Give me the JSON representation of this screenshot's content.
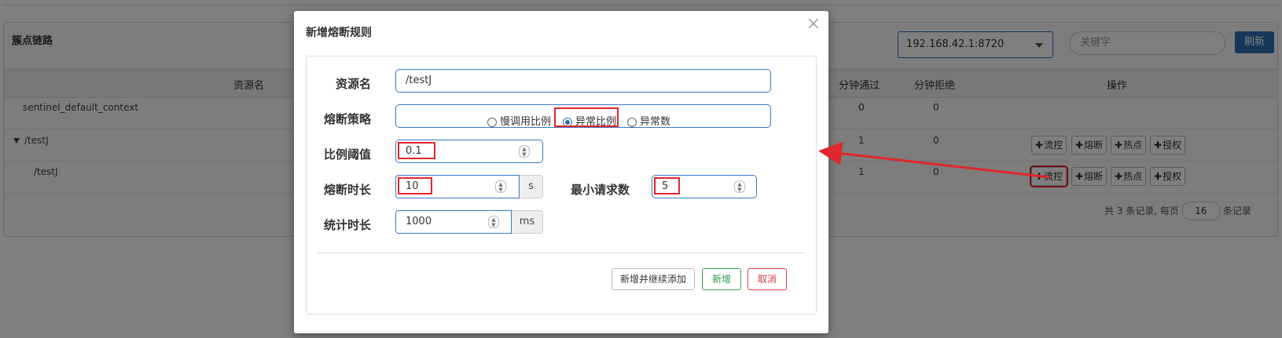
{
  "panel": {
    "title": "簇点链路",
    "machine_select": "192.168.42.1:8720",
    "keyword_placeholder": "关键字",
    "refresh_label": "刷新"
  },
  "table": {
    "headers": {
      "resource": "资源名",
      "pass_min": "分钟通过",
      "block_min": "分钟拒绝",
      "ops": "操作"
    },
    "rows": [
      {
        "name": "sentinel_default_context",
        "pass": "0",
        "block": "0",
        "show_ops": false
      },
      {
        "name": "/testJ",
        "pass": "1",
        "block": "0",
        "show_ops": true
      },
      {
        "name": "/testJ",
        "pass": "1",
        "block": "0",
        "show_ops": true
      }
    ],
    "op_labels": [
      "流控",
      "熔断",
      "热点",
      "授权"
    ]
  },
  "pager": {
    "prefix": "共 3 条记录, 每页",
    "page_size": "16",
    "suffix": "条记录"
  },
  "modal": {
    "title": "新增熔断规则",
    "close": "×",
    "resource_label": "资源名",
    "resource_value": "/testJ",
    "strategy_label": "熔断策略",
    "strategy_options": [
      "慢调用比例",
      "异常比例",
      "异常数"
    ],
    "selected_strategy": "异常比例",
    "ratio_label": "比例阈值",
    "ratio_value": "0.1",
    "duration_label": "熔断时长",
    "duration_value": "10",
    "duration_unit": "s",
    "min_req_label": "最小请求数",
    "min_req_value": "5",
    "stat_label": "统计时长",
    "stat_value": "1000",
    "stat_unit": "ms",
    "btn_continue": "新增并继续添加",
    "btn_add": "新增",
    "btn_cancel": "取消"
  },
  "colors": {
    "primary": "#2f6cb3",
    "annotation_red": "#e0272b",
    "success": "#2c9a4d",
    "danger": "#d03a45"
  }
}
